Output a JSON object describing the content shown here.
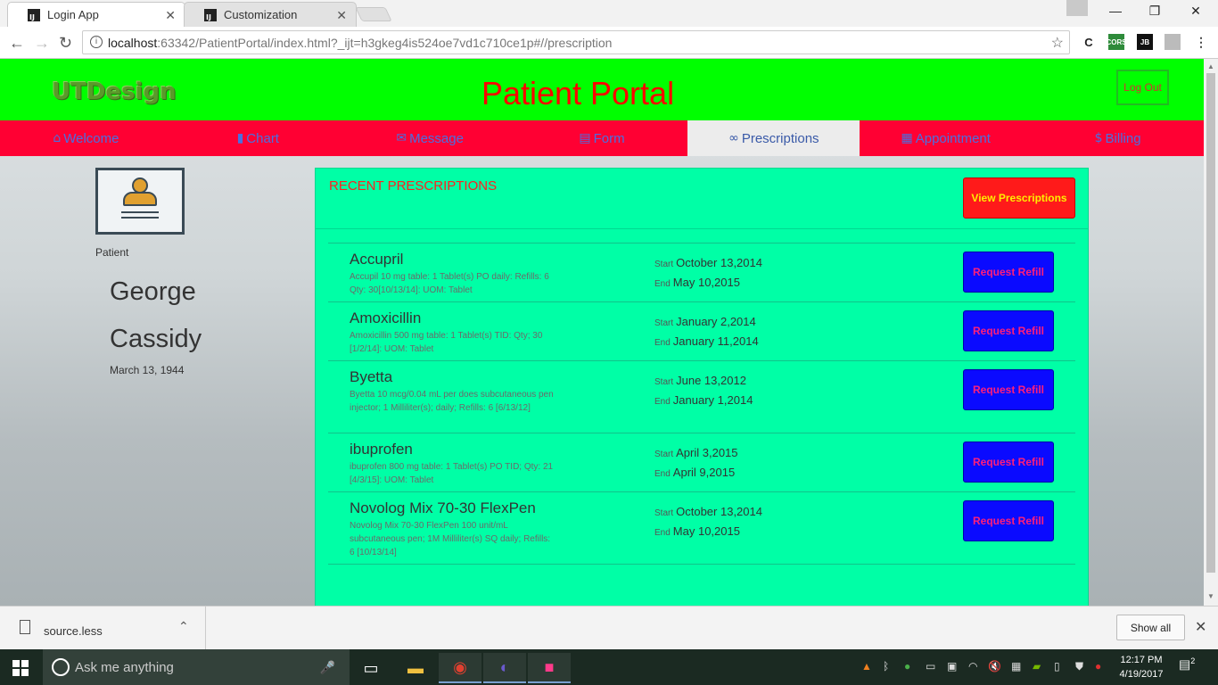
{
  "browser": {
    "tabs": [
      {
        "title": "Login App"
      },
      {
        "title": "Customization"
      }
    ],
    "url_host": "localhost",
    "url_rest": ":63342/PatientPortal/index.html?_ijt=h3gkeg4is524oe7vd1c710ce1p#//prescription"
  },
  "header": {
    "brand": "UTDesign",
    "title": "Patient Portal",
    "logout_label": "Log Out"
  },
  "nav": {
    "tabs": [
      {
        "icon": "home-icon",
        "label": "Welcome"
      },
      {
        "icon": "bar-chart-icon",
        "label": "Chart"
      },
      {
        "icon": "envelope-icon",
        "label": "Message"
      },
      {
        "icon": "file-icon",
        "label": "Form"
      },
      {
        "icon": "link-icon",
        "label": "Prescriptions"
      },
      {
        "icon": "calendar-icon",
        "label": "Appointment"
      },
      {
        "icon": "dollar-icon",
        "label": "Billing"
      }
    ],
    "active_tab": "Prescriptions"
  },
  "patient": {
    "label": "Patient",
    "first_name": "George",
    "last_name": "Cassidy",
    "dob": "March 13, 1944"
  },
  "prescriptions": {
    "title": "RECENT PRESCRIPTIONS",
    "view_button": "View Prescriptions",
    "start_label": "Start",
    "end_label": "End",
    "refill_label": "Request Refill",
    "items": [
      {
        "name": "Accupril",
        "desc": "Accupil 10 mg table: 1 Tablet(s) PO daily: Refills: 6 Qty: 30[10/13/14]: UOM: Tablet",
        "start": "October 13,2014",
        "end": "May 10,2015"
      },
      {
        "name": "Amoxicillin",
        "desc": "Amoxicillin 500 mg table: 1 Tablet(s) TID: Qty; 30 [1/2/14]: UOM: Tablet",
        "start": "January 2,2014",
        "end": "January 11,2014"
      },
      {
        "name": "Byetta",
        "desc": "Byetta 10 mcg/0.04 mL per does subcutaneous pen injector; 1 Milliliter(s); daily; Refills: 6 [6/13/12]",
        "start": "June 13,2012",
        "end": "January 1,2014"
      },
      {
        "name": "ibuprofen",
        "desc": "ibuprofen 800 mg table: 1 Tablet(s) PO TID; Qty: 21 [4/3/15]: UOM: Tablet",
        "start": "April 3,2015",
        "end": "April 9,2015"
      },
      {
        "name": "Novolog Mix 70-30 FlexPen",
        "desc": "Novolog Mix 70-30 FlexPen 100 unit/mL subcutaneous pen; 1M Milliliter(s) SQ daily; Refills: 6 [10/13/14]",
        "start": "October 13,2014",
        "end": "May 10,2015"
      }
    ]
  },
  "downloads": {
    "file": "source.less",
    "show_all": "Show all"
  },
  "taskbar": {
    "search_placeholder": "Ask me anything",
    "time": "12:17 PM",
    "date": "4/19/2017",
    "notifications": "2"
  }
}
